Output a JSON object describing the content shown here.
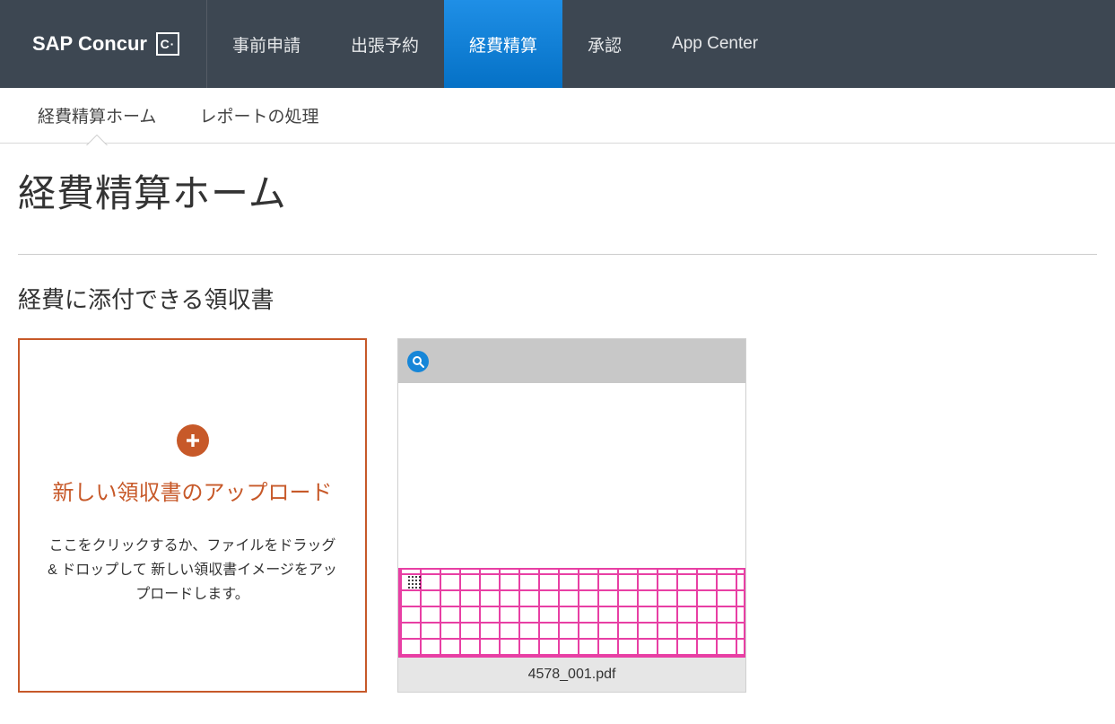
{
  "brand": {
    "name": "SAP Concur",
    "logo_letter": "C·"
  },
  "topnav": {
    "items": [
      {
        "label": "事前申請",
        "active": false
      },
      {
        "label": "出張予約",
        "active": false
      },
      {
        "label": "経費精算",
        "active": true
      },
      {
        "label": "承認",
        "active": false
      },
      {
        "label": "App Center",
        "active": false
      }
    ]
  },
  "subnav": {
    "items": [
      {
        "label": "経費精算ホーム",
        "active": true
      },
      {
        "label": "レポートの処理",
        "active": false
      }
    ]
  },
  "page": {
    "title": "経費精算ホーム",
    "section_title": "経費に添付できる領収書"
  },
  "upload_card": {
    "title": "新しい領収書のアップロード",
    "description": "ここをクリックするか、ファイルをドラッグ & ドロップして 新しい領収書イメージをアップロードします。"
  },
  "receipt_card": {
    "filename": "4578_001.pdf"
  }
}
